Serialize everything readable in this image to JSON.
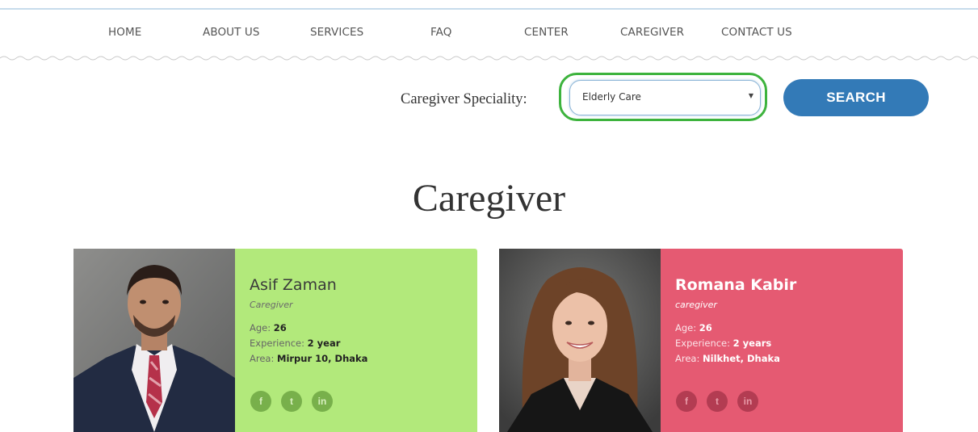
{
  "nav": {
    "items": [
      "HOME",
      "ABOUT US",
      "SERVICES",
      "FAQ",
      "CENTER",
      "CAREGIVER",
      "CONTACT US"
    ]
  },
  "search": {
    "label": "Caregiver Speciality:",
    "selected": "Elderly Care",
    "button": "SEARCH"
  },
  "section": {
    "title": "Caregiver"
  },
  "caregivers": [
    {
      "name": "Asif Zaman",
      "role": "Caregiver",
      "age_label": "Age:",
      "age": "26",
      "experience_label": "Experience:",
      "experience": "2 year",
      "area_label": "Area:",
      "area": "Mirpur 10, Dhaka",
      "color": "#b2e97b"
    },
    {
      "name": "Romana Kabir",
      "role": "caregiver",
      "age_label": "Age:",
      "age": "26",
      "experience_label": "Experience:",
      "experience": "2 years",
      "area_label": "Area:",
      "area": "Nilkhet, Dhaka",
      "color": "#e55a72"
    }
  ],
  "social": [
    "facebook-icon",
    "twitter-icon",
    "linkedin-icon"
  ],
  "social_glyphs": [
    "f",
    "t",
    "in"
  ],
  "colors": {
    "accent": "#337ab7",
    "highlight": "#3db33d"
  }
}
